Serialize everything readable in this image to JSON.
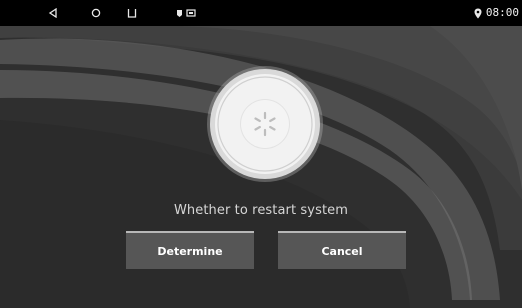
{
  "status_bar": {
    "time": "08:00",
    "icons": [
      "back-icon",
      "home-icon",
      "recent-apps-icon",
      "notification-icons",
      "location-icon"
    ]
  },
  "dialog": {
    "message": "Whether to restart system",
    "confirm_label": "Determine",
    "cancel_label": "Cancel",
    "icon": "loading-spinner-icon"
  },
  "colors": {
    "background": "#2f2f2f",
    "status_bar": "#000000",
    "button": "#565656",
    "button_top_border": "#b8b8b8",
    "text": "#d6d6d6"
  }
}
